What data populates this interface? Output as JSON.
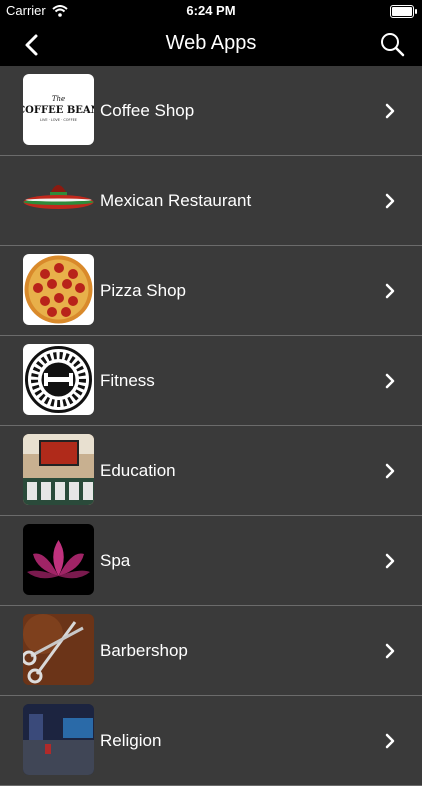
{
  "status_bar": {
    "carrier": "Carrier",
    "time": "6:24 PM",
    "battery_level": 1.0
  },
  "nav": {
    "title": "Web Apps",
    "back_icon": "chevron-left-icon",
    "search_icon": "search-icon"
  },
  "logo_text": {
    "coffee_line1": "The",
    "coffee_line2": "COFFEE BEAN",
    "coffee_line3": "LIVE · LOVE · COFFEE"
  },
  "items": [
    {
      "label": "Coffee Shop"
    },
    {
      "label": "Mexican Restaurant"
    },
    {
      "label": "Pizza Shop"
    },
    {
      "label": "Fitness"
    },
    {
      "label": "Education"
    },
    {
      "label": "Spa"
    },
    {
      "label": "Barbershop"
    },
    {
      "label": "Religion"
    }
  ],
  "colors": {
    "background": "#3a3a3a",
    "bar": "#000000",
    "separator": "#6b6b6b"
  }
}
